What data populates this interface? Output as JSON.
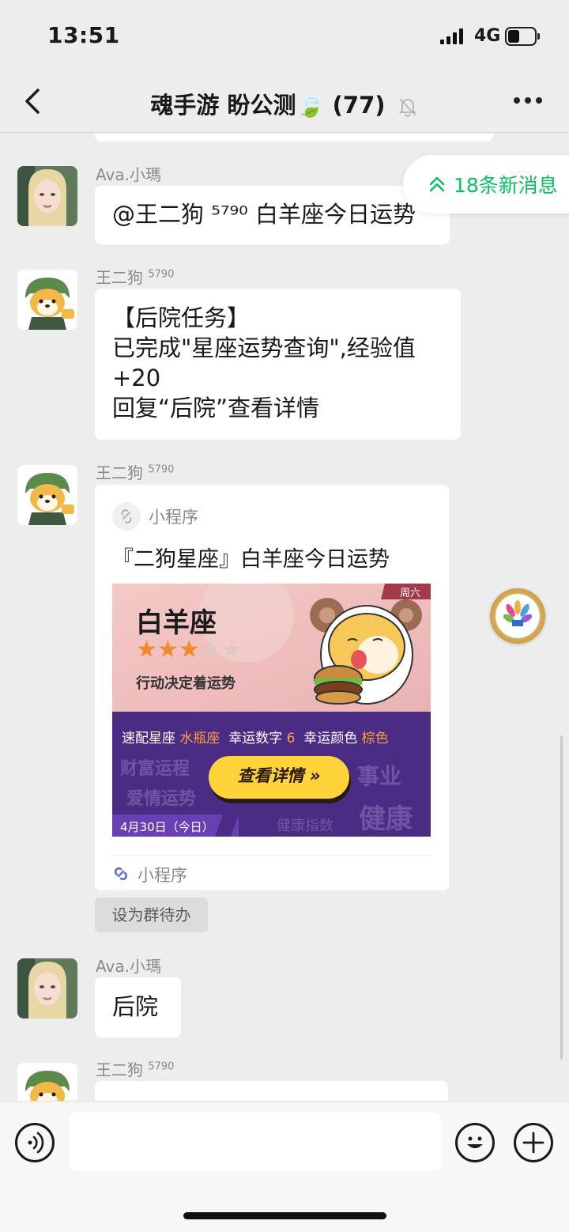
{
  "status_bar": {
    "time": "13:51",
    "network": "4G"
  },
  "nav": {
    "title": "魂手游 盼公测🍃 (77)"
  },
  "new_messages": {
    "label": "18条新消息"
  },
  "messages": [
    {
      "sender": "Ava.小瑪",
      "text": "@王二狗 ⁵⁷⁹⁰ 白羊座今日运势"
    },
    {
      "sender": "王二狗",
      "sender_sup": "5790",
      "lines": [
        "【后院任务】",
        "已完成\"星座运势查询\",经验值",
        "+20",
        "回复“后院”查看详情"
      ]
    },
    {
      "sender": "王二狗",
      "sender_sup": "5790"
    },
    {
      "sender": "Ava.小瑪",
      "text": "后院"
    },
    {
      "sender": "王二狗",
      "sender_sup": "5790"
    }
  ],
  "mini_program": {
    "app_name": "小程序",
    "title": "『二狗星座』白羊座今日运势",
    "card": {
      "sign": "白羊座",
      "stars_filled": 3,
      "stars_total": 5,
      "motto": "行动决定着运势",
      "day_tag": "周六",
      "match_label": "速配星座",
      "match_value": "水瓶座",
      "lucky_number_label": "幸运数字",
      "lucky_number_value": "6",
      "lucky_color_label": "幸运颜色",
      "lucky_color_value": "棕色",
      "bg_words": [
        "财富运程",
        "爱情运势",
        "事业",
        "健康指数",
        "健康"
      ],
      "button": "查看详情 »",
      "date": "4月30日（今日）"
    },
    "footer": "小程序"
  },
  "todo_chip": "设为群待办",
  "colors": {
    "accent_green": "#07c160",
    "card_purple": "#4b2c84",
    "button_yellow": "#ffd43b"
  }
}
